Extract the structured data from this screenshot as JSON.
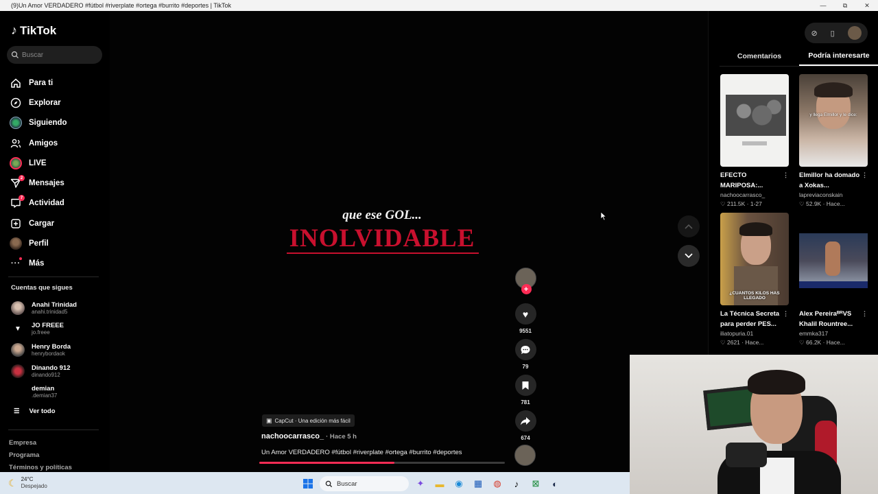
{
  "window": {
    "title": "(9)Un Amor VERDADERO #fútbol #riverplate #ortega #burrito #deportes | TikTok",
    "minimize": "—",
    "maximize": "⧉",
    "close": "✕"
  },
  "sidebar": {
    "logo": "TikTok",
    "search_placeholder": "Buscar",
    "nav": [
      {
        "label": "Para ti",
        "icon": "home-icon"
      },
      {
        "label": "Explorar",
        "icon": "compass-icon"
      },
      {
        "label": "Siguiendo",
        "icon": "following-icon"
      },
      {
        "label": "Amigos",
        "icon": "friends-icon"
      },
      {
        "label": "LIVE",
        "icon": "live-icon"
      },
      {
        "label": "Mensajes",
        "icon": "messages-icon",
        "badge": "2"
      },
      {
        "label": "Actividad",
        "icon": "activity-icon",
        "badge": "7"
      },
      {
        "label": "Cargar",
        "icon": "upload-icon"
      },
      {
        "label": "Perfil",
        "icon": "profile-avatar"
      },
      {
        "label": "Más",
        "icon": "more-icon"
      }
    ],
    "following_title": "Cuentas que sigues",
    "following": [
      {
        "name": "Anahi Trinidad",
        "handle": "anahi.trinidad5"
      },
      {
        "name": "JO FREEE",
        "handle": "jo.freee"
      },
      {
        "name": "Henry Borda",
        "handle": "henrybordaok"
      },
      {
        "name": "Dinando 912",
        "handle": "dinando912"
      },
      {
        "name": "demian",
        "handle": ".demian37"
      }
    ],
    "see_all": "Ver todo",
    "footer": [
      "Empresa",
      "Programa",
      "Términos y políticas"
    ]
  },
  "video": {
    "overlay_line1": "que ese GOL...",
    "overlay_line2": "INOLVIDABLE",
    "capcut": "CapCut · Una edición más fácil",
    "author": "nachoocarrasco_",
    "time": "· Hace 5 h",
    "caption": "Un Amor VERDADERO #fútbol #riverplate #ortega #burrito #deportes",
    "progress": 0.55,
    "likes": "9551",
    "comments": "79",
    "saves": "781",
    "shares": "674"
  },
  "panel": {
    "tabs": [
      "Comentarios",
      "Podría interesarte"
    ],
    "active_tab": 1,
    "cards": [
      {
        "title": "EFECTO MARIPOSA:...",
        "author": "nachoocarrasco_",
        "likes": "211.5K",
        "when": "1-27",
        "thumb_caption": ""
      },
      {
        "title": "Elmillor ha domado a Xokas...",
        "author": "lapreviaconskain",
        "likes": "52.9K",
        "when": "Hace...",
        "thumb_caption": "y llega Elmillor y le dice:"
      },
      {
        "title": "La Técnica Secreta para perder PES...",
        "author": "iliatopuria.01",
        "likes": "2621",
        "when": "Hace...",
        "thumb_caption": "¿CUANTOS KILOS HAS LLEGADO"
      },
      {
        "title": "Alex PereiraᴮᴿVS Khalil Rountree...",
        "author": "emmka317",
        "likes": "66.2K",
        "when": "Hace...",
        "thumb_caption": ""
      }
    ]
  },
  "taskbar": {
    "temp": "24°C",
    "weather": "Despejado",
    "search": "Buscar"
  },
  "colors": {
    "accent": "#fe2c55",
    "overlay_red": "#c8102e"
  }
}
